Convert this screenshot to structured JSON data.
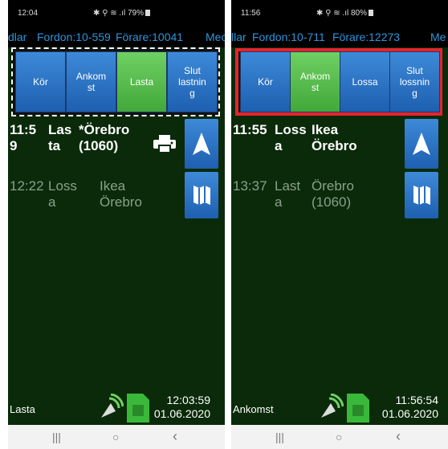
{
  "left": {
    "status_time": "12:04",
    "status_icons": "✱ ⚲ ≋ .ıl 79%",
    "info_prefix": "dlar",
    "info_fordon": "Fordon:10-559",
    "info_forare": "Förare:10041",
    "info_suffix": "Mec",
    "buttons": [
      {
        "line1": "Kör",
        "line2": "",
        "line3": "",
        "color": "blue"
      },
      {
        "line1": "Ankom",
        "line2": "st",
        "line3": "",
        "color": "blue"
      },
      {
        "line1": "Lasta",
        "line2": "",
        "line3": "",
        "color": "green"
      },
      {
        "line1": "Slut",
        "line2": "lastnin",
        "line3": "g",
        "color": "blue"
      }
    ],
    "trips": [
      {
        "time1": "11:5",
        "time2": "9",
        "act1": "Las",
        "act2": "ta",
        "dest1": "*Örebro",
        "dest2": "(1060)"
      },
      {
        "time1": "12:22",
        "time2": "",
        "act1": "Loss",
        "act2": "a",
        "dest1": "Ikea",
        "dest2": "Örebro"
      }
    ],
    "bottom_status": "Lasta",
    "clock_time": "12:03:59",
    "clock_date": "01.06.2020"
  },
  "right": {
    "status_time": "11:56",
    "status_icons": "✱ ⚲ ≋ .ıl 80%",
    "info_prefix": "llar",
    "info_fordon": "Fordon:10-711",
    "info_forare": "Förare:12273",
    "info_suffix": "Me",
    "buttons": [
      {
        "line1": "Kör",
        "line2": "",
        "line3": "",
        "color": "blue"
      },
      {
        "line1": "Ankom",
        "line2": "st",
        "line3": "",
        "color": "green"
      },
      {
        "line1": "Lossa",
        "line2": "",
        "line3": "",
        "color": "blue"
      },
      {
        "line1": "Slut",
        "line2": "lossnin",
        "line3": "g",
        "color": "blue"
      }
    ],
    "trips": [
      {
        "time1": "11:55",
        "time2": "",
        "act1": "Loss",
        "act2": "a",
        "dest1": "Ikea",
        "dest2": "Örebro"
      },
      {
        "time1": "13:37",
        "time2": "",
        "act1": "Last",
        "act2": "a",
        "dest1": "Örebro",
        "dest2": "(1060)"
      }
    ],
    "bottom_status": "Ankomst",
    "clock_time": "11:56:54",
    "clock_date": "01.06.2020"
  },
  "nav": {
    "recents": "|||",
    "home": "○",
    "back": "‹"
  },
  "colors": {
    "blue_button": "#2c74c6",
    "green_button": "#5cc04f",
    "background": "#0a2a0a",
    "info_text": "#2d95dc",
    "highlight_red": "#e8232b"
  }
}
